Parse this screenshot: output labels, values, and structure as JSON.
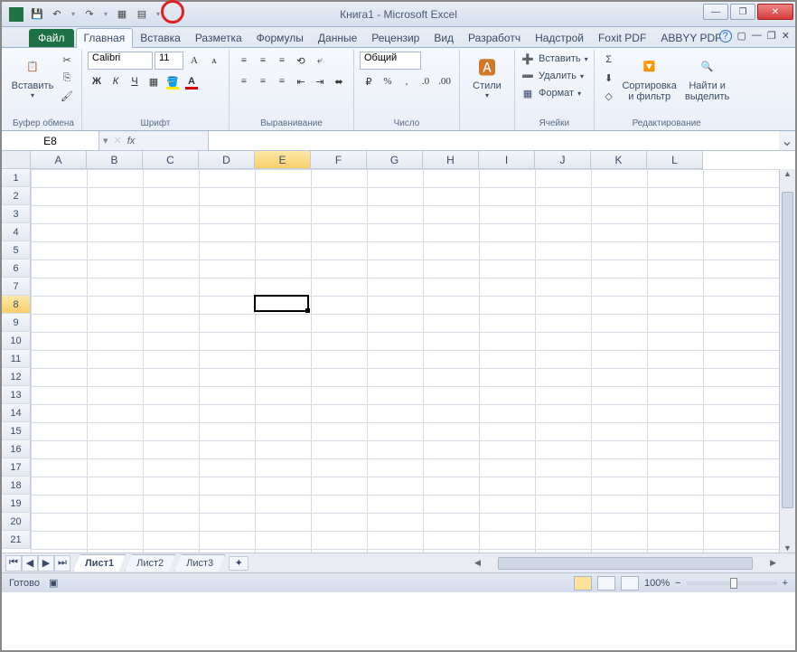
{
  "title": "Книга1  -  Microsoft Excel",
  "qat": {
    "save": "save",
    "undo": "undo",
    "redo": "redo"
  },
  "tabs": {
    "file": "Файл",
    "items": [
      "Главная",
      "Вставка",
      "Разметка",
      "Формулы",
      "Данные",
      "Рецензир",
      "Вид",
      "Разработч",
      "Надстрой",
      "Foxit PDF",
      "ABBYY PDF"
    ],
    "active": 0
  },
  "ribbon": {
    "clipboard": {
      "label": "Буфер обмена",
      "paste": "Вставить"
    },
    "font": {
      "label": "Шрифт",
      "name": "Calibri",
      "size": "11"
    },
    "alignment": {
      "label": "Выравнивание"
    },
    "number": {
      "label": "Число",
      "format": "Общий"
    },
    "styles": {
      "label": "Стили",
      "btn": "Стили"
    },
    "cells": {
      "label": "Ячейки",
      "insert": "Вставить",
      "delete": "Удалить",
      "format": "Формат"
    },
    "editing": {
      "label": "Редактирование",
      "sort": "Сортировка и фильтр",
      "find": "Найти и выделить"
    }
  },
  "namebox": "E8",
  "fx": "fx",
  "columns": [
    "A",
    "B",
    "C",
    "D",
    "E",
    "F",
    "G",
    "H",
    "I",
    "J",
    "K",
    "L"
  ],
  "rows": [
    1,
    2,
    3,
    4,
    5,
    6,
    7,
    8,
    9,
    10,
    11,
    12,
    13,
    14,
    15,
    16,
    17,
    18,
    19,
    20,
    21
  ],
  "activeCol": 4,
  "activeRow": 7,
  "sheets": {
    "tabs": [
      "Лист1",
      "Лист2",
      "Лист3"
    ],
    "active": 0
  },
  "status": {
    "ready": "Готово",
    "zoom": "100%"
  }
}
